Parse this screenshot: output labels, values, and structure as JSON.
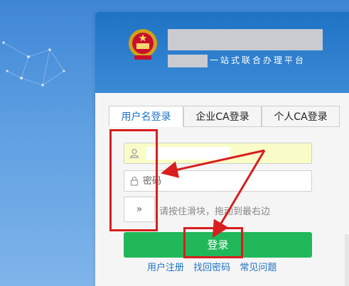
{
  "header": {
    "subtitle": "一站式联合办理平台",
    "emblem_icon": "national-emblem-icon"
  },
  "tabs": [
    {
      "label": "用户名登录",
      "active": true
    },
    {
      "label": "企业CA登录",
      "active": false
    },
    {
      "label": "个人CA登录",
      "active": false
    }
  ],
  "form": {
    "username": {
      "value": "",
      "placeholder": "",
      "icon": "user-icon"
    },
    "password": {
      "placeholder": "密码",
      "icon": "lock-icon"
    },
    "slider": {
      "handle": "»",
      "hint": "请按住滑块，拖动到最右边"
    }
  },
  "login_button": "登录",
  "links": [
    "用户注册",
    "找回密码",
    "常见问题"
  ],
  "colors": {
    "header_blue": "#1f73c4",
    "login_green": "#21b85a",
    "annotation_red": "#d81e1e",
    "autofill_yellow": "#fafcc8"
  }
}
